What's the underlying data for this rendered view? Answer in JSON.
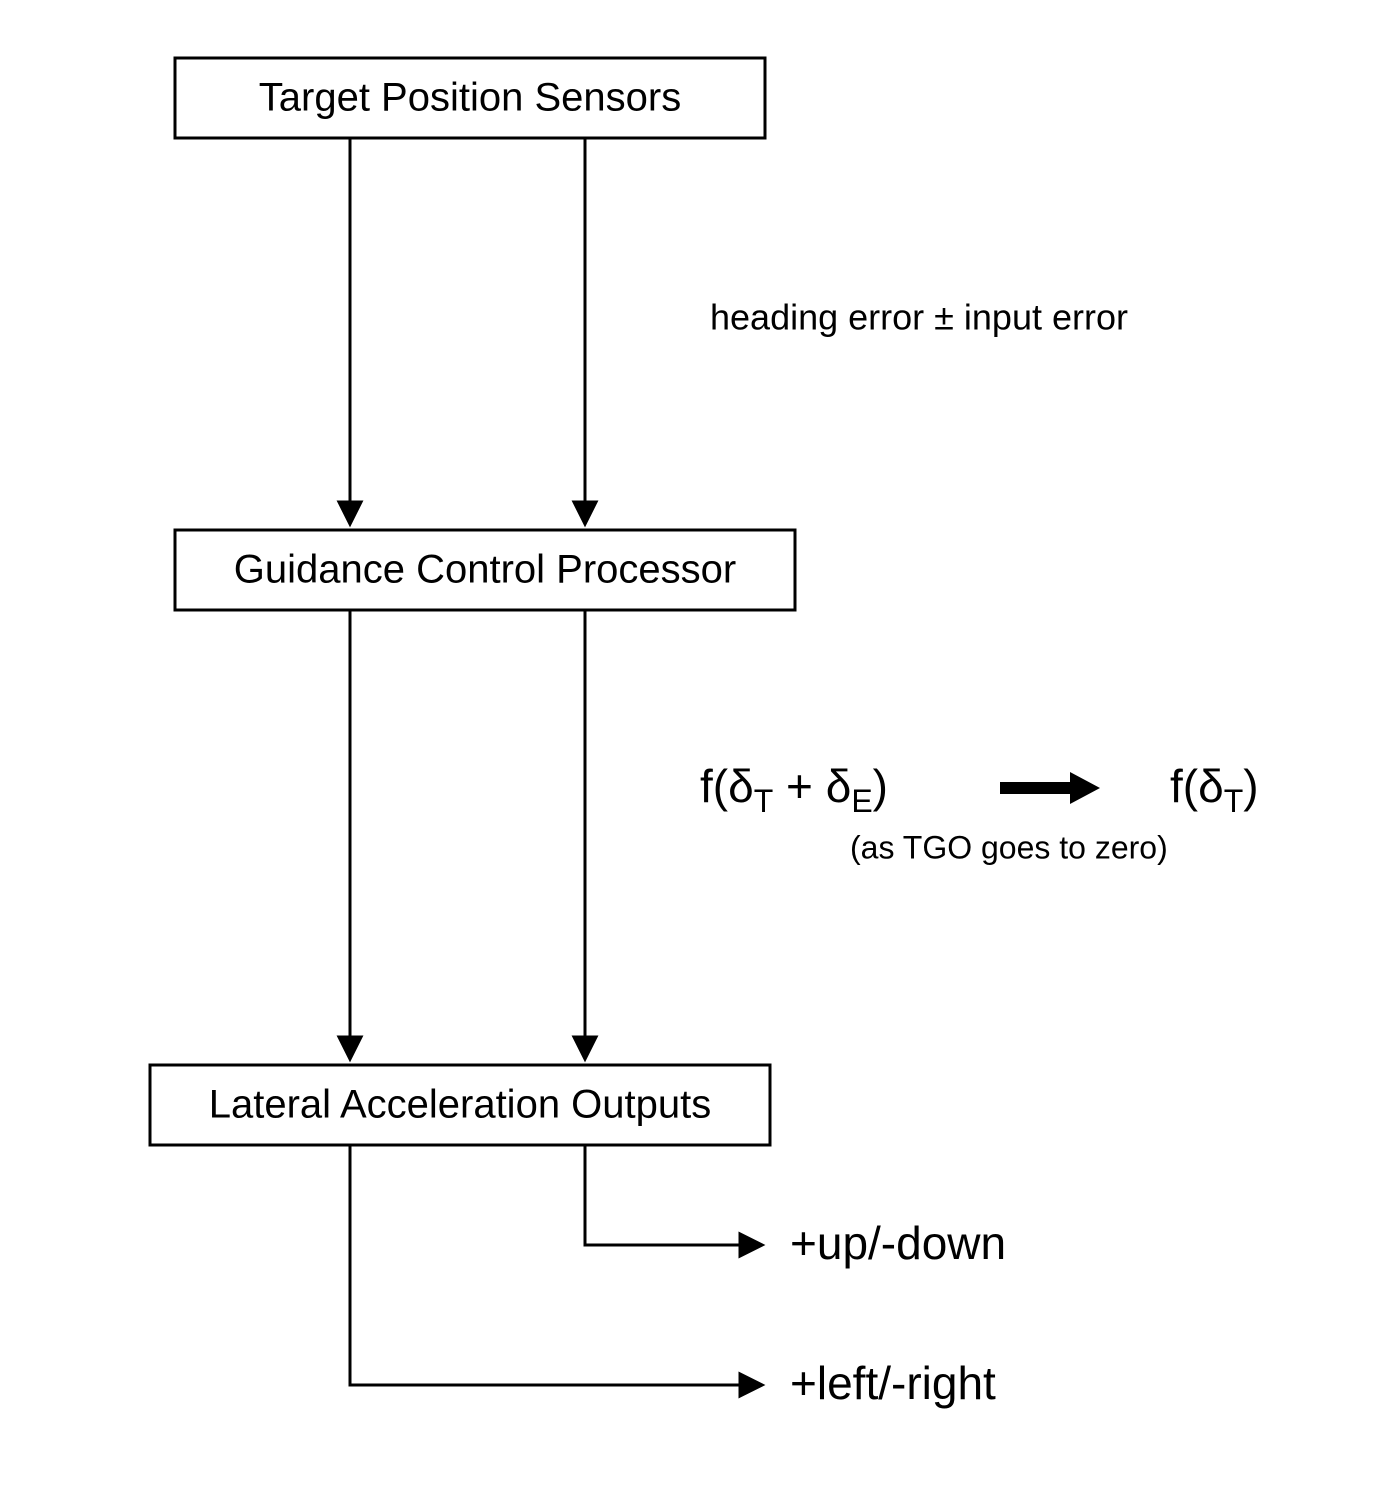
{
  "boxes": {
    "sensors": "Target Position Sensors",
    "processor": "Guidance Control Processor",
    "outputs": "Lateral Acceleration Outputs"
  },
  "annotations": {
    "heading_error": "heading error ± input error",
    "tgo_note": "(as TGO goes to zero)",
    "updown": "+up/-down",
    "leftright": "+left/-right"
  },
  "formula": {
    "lhs_prefix": "f(",
    "delta": "δ",
    "sub_T": "T",
    "plus": " + ",
    "sub_E": "E",
    "rhs_suffix": ")"
  }
}
